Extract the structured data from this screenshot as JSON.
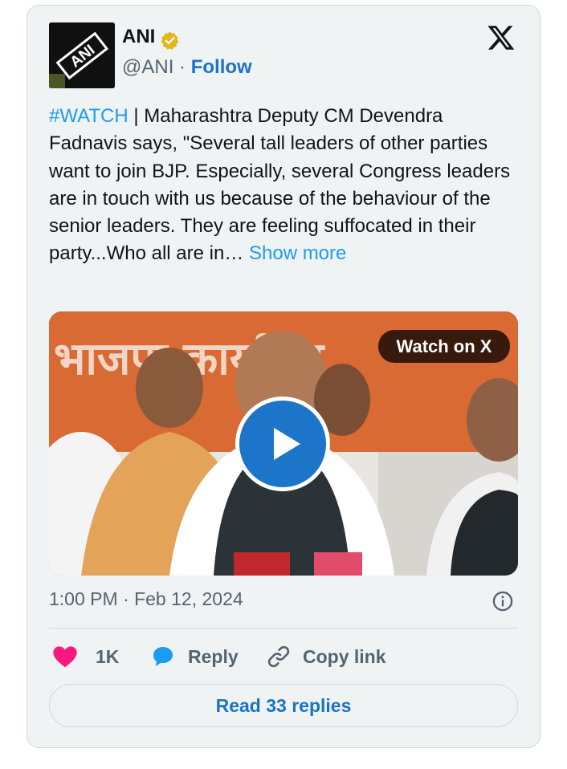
{
  "author": {
    "name": "ANI",
    "handle": "@ANI",
    "separator": "·",
    "follow_label": "Follow",
    "avatar_text": "ANI"
  },
  "tweet": {
    "hashtag": "#WATCH",
    "text": " | Maharashtra Deputy CM Devendra Fadnavis says, \"Several tall leaders of other parties want to join BJP. Especially, several Congress leaders are in touch with us because of the behaviour of the senior leaders. They are feeling suffocated in their party...Who all are in… ",
    "show_more": "Show more"
  },
  "media": {
    "watch_label": "Watch on X",
    "banner_text": "भाजपा कार्यालय"
  },
  "meta": {
    "timestamp": "1:00 PM · Feb 12, 2024"
  },
  "actions": {
    "likes": "1K",
    "reply_label": "Reply",
    "copy_label": "Copy link",
    "read_replies": "Read 33 replies"
  },
  "colors": {
    "accent": "#1d9bf0",
    "like": "#f91880",
    "verified": "#e2b719"
  },
  "icons": [
    "verified-badge-icon",
    "x-logo-icon",
    "play-icon",
    "info-icon",
    "heart-icon",
    "reply-bubble-icon",
    "link-icon"
  ]
}
